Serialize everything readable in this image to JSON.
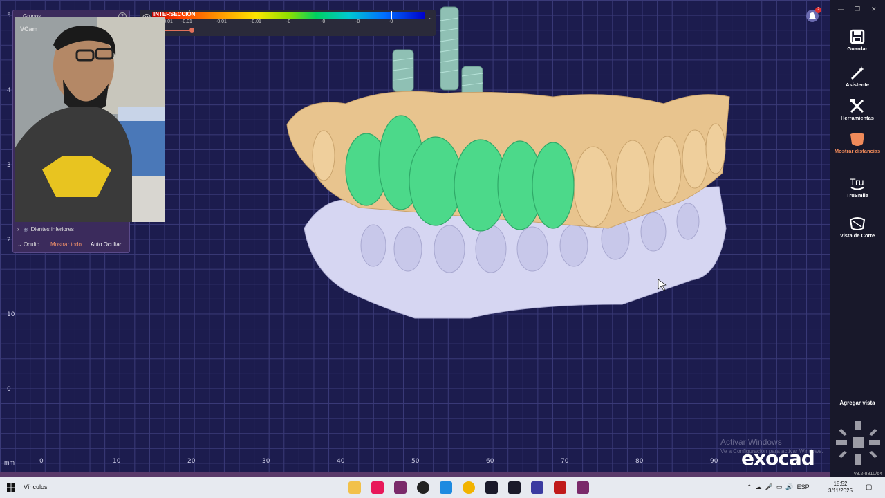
{
  "colorbar": {
    "title": "INTERSECCIÓN",
    "ticks": [
      "-0.01",
      "-0.01",
      "-0.01",
      "-0.01",
      "-0",
      "-0",
      "-0",
      "-0"
    ],
    "close_icon": "close-icon"
  },
  "groups": {
    "header": "Grupos",
    "webcam_label": "VCam",
    "row_lower_teeth": "Dientes inferiores",
    "hidden_label": "Oculto",
    "show_all": "Mostrar todo",
    "auto_hide": "Auto Ocultar"
  },
  "ruler": {
    "bottom": [
      "0",
      "10",
      "20",
      "30",
      "40",
      "50",
      "60",
      "70",
      "80",
      "90"
    ],
    "left": [
      "5",
      "4",
      "3",
      "2",
      "10",
      "0"
    ],
    "unit": "mm"
  },
  "sidebar": {
    "items": [
      {
        "label": "Guardar",
        "icon": "save-icon"
      },
      {
        "label": "Asistente",
        "icon": "wand-icon"
      },
      {
        "label": "Herramientas",
        "icon": "tools-icon"
      },
      {
        "label": "Mostrar distancias",
        "icon": "distance-icon"
      },
      {
        "label": "TruSmile",
        "icon": "trusmile-icon"
      },
      {
        "label": "Vista de Corte",
        "icon": "section-view-icon"
      }
    ],
    "add_view": "Agregar vista",
    "version": "v3.2-8810/64"
  },
  "notification": {
    "count": "2"
  },
  "watermark": {
    "line1": "Activar Windows",
    "line2": "Ve a Configuración para activar Windows."
  },
  "logo": "exocad",
  "taskbar": {
    "search_label": "Vínculos",
    "lang": "ESP",
    "time": "18:52",
    "date": "3/11/2025"
  },
  "colors": {
    "accent": "#f08a5a",
    "viewport_bg": "#1c1c4e",
    "crown_green": "#4cd98a",
    "model_beige": "#e8c48e",
    "model_lavender": "#d6d6f2"
  }
}
